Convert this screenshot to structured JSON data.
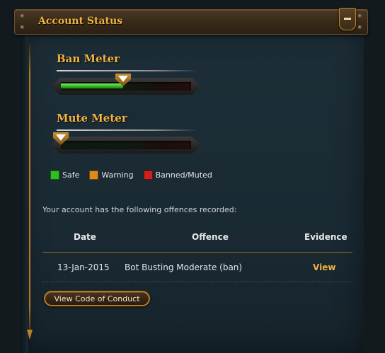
{
  "header": {
    "title": "Account Status",
    "collapse_icon": "minus-icon"
  },
  "ban_meter": {
    "title": "Ban Meter",
    "level": 0.48
  },
  "mute_meter": {
    "title": "Mute Meter",
    "level": 0.0
  },
  "legend": [
    {
      "label": "Safe",
      "color": "#2fbf1f"
    },
    {
      "label": "Warning",
      "color": "#e08a1a"
    },
    {
      "label": "Banned/Muted",
      "color": "#d01f1f"
    }
  ],
  "offences": {
    "intro": "Your account has the following offences recorded:",
    "headers": {
      "date": "Date",
      "offence": "Offence",
      "evidence": "Evidence"
    },
    "rows": [
      {
        "date": "13-Jan-2015",
        "offence": "Bot Busting Moderate (ban)",
        "evidence": "View"
      }
    ]
  },
  "buttons": {
    "code_of_conduct": "View Code of Conduct"
  },
  "colors": {
    "accent": "#f0b341",
    "panel": "#1a2a33"
  }
}
